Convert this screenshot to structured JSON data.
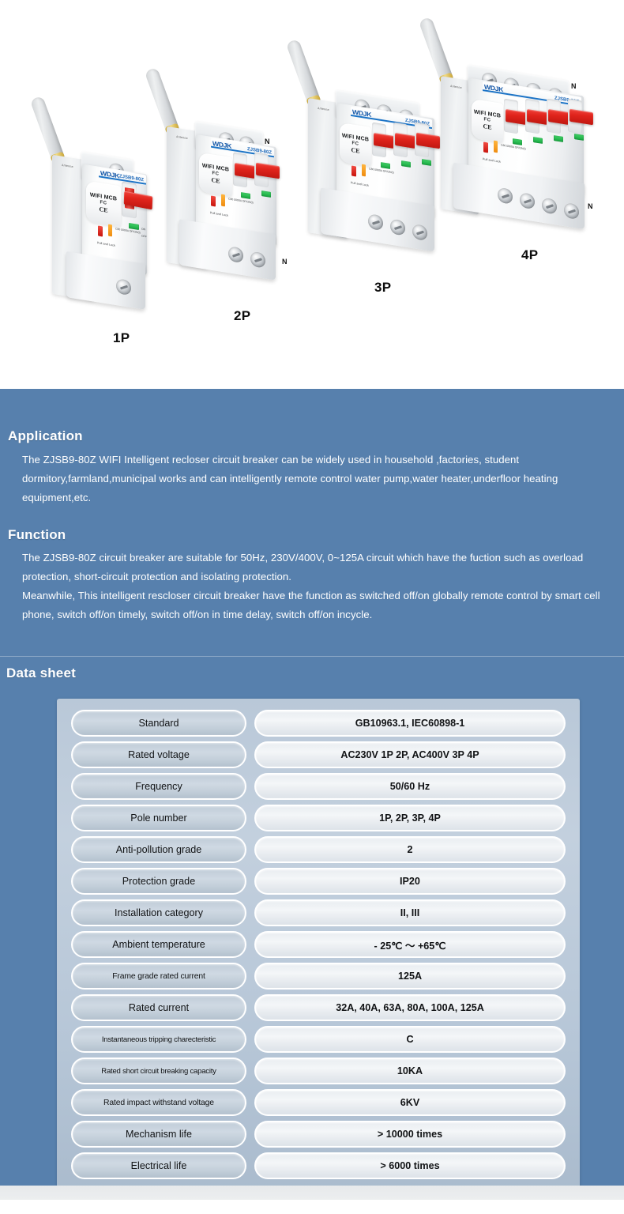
{
  "hero": {
    "product": {
      "wifi_label": "WIFI MCB",
      "marks_label": "FC",
      "ce_label": "CE",
      "brand_logo": "WDJK",
      "brand_model": "ZJSB9-80Z",
      "antenna_side_text": "Antenna",
      "lock_text": "Pull and Lock",
      "micro_left": "I 2",
      "micro_curve": "C80\n5000A\nOF/ON(I)",
      "micro_on": "ON",
      "micro_off": "OFF",
      "neutral_mark": "N"
    },
    "captions": [
      {
        "label": "1P"
      },
      {
        "label": "2P"
      },
      {
        "label": "3P"
      },
      {
        "label": "4P"
      }
    ]
  },
  "application": {
    "heading": "Application",
    "text": "The ZJSB9-80Z WIFI Intelligent recloser circuit breaker can be widely used in household ,factories, student dormitory,farmland,municipal works and can intelligently remote control water pump,water heater,underfloor heating equipment,etc."
  },
  "function": {
    "heading": "Function",
    "text_line1": "The ZJSB9-80Z circuit breaker are suitable for 50Hz, 230V/400V, 0~125A circuit which have the fuction such as overload protection, short-circuit protection and isolating protection.",
    "text_line2": "Meanwhile, This intelligent rescloser circuit breaker have the function as switched off/on globally remote control by smart cell phone, switch off/on timely, switch off/on in time delay, switch off/on incycle."
  },
  "datasheet": {
    "heading": "Data sheet",
    "rows": [
      {
        "label": "Standard",
        "value": "GB10963.1, IEC60898-1",
        "size": ""
      },
      {
        "label": "Rated voltage",
        "value": "AC230V 1P 2P, AC400V 3P 4P",
        "size": ""
      },
      {
        "label": "Frequency",
        "value": "50/60 Hz",
        "size": ""
      },
      {
        "label": "Pole number",
        "value": "1P, 2P, 3P, 4P",
        "size": ""
      },
      {
        "label": "Anti-pollution grade",
        "value": "2",
        "size": ""
      },
      {
        "label": "Protection grade",
        "value": "IP20",
        "size": ""
      },
      {
        "label": "Installation category",
        "value": "II, III",
        "size": ""
      },
      {
        "label": "Ambient temperature",
        "value": "- 25℃ ～ +65℃",
        "size": ""
      },
      {
        "label": "Frame grade rated current",
        "value": "125A",
        "size": "sm"
      },
      {
        "label": "Rated current",
        "value": "32A, 40A, 63A, 80A, 100A, 125A",
        "size": ""
      },
      {
        "label": "Instantaneous tripping charecteristic",
        "value": "C",
        "size": "xs"
      },
      {
        "label": "Rated short circuit breaking capacity",
        "value": "10KA",
        "size": "xs"
      },
      {
        "label": "Rated impact withstand voltage",
        "value": "6KV",
        "size": "sm"
      },
      {
        "label": "Mechanism life",
        "value": "> 10000 times",
        "size": ""
      },
      {
        "label": "Electrical life",
        "value": "> 6000 times",
        "size": ""
      }
    ]
  },
  "colors": {
    "panel_blue": "#5780ad",
    "table_bg": "#bcc9d8",
    "lever_red": "#d8211a",
    "brand_blue": "#1b73c6",
    "indicator_green": "#1ea846"
  }
}
